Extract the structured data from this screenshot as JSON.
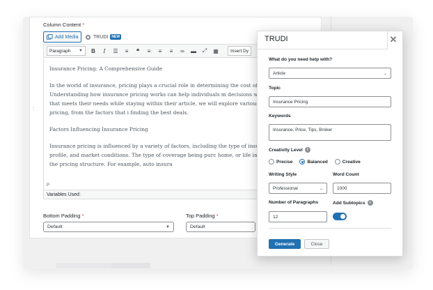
{
  "editor": {
    "column_label": "Column Content",
    "required_mark": "*",
    "add_media_label": "Add Media",
    "trudi_tab_label": "TRUDI",
    "new_badge": "NEW",
    "format_select": "Paragraph",
    "insert_label": "Insert Dy",
    "paragraphs": [
      "Insurance Pricing: A Comprehensive Guide",
      "In the world of insurance, pricing plays a crucial role in determining the cost of co policyholders. Understanding how insurance pricing works can help individuals m decisions when selecting a policy that meets their needs while staying within their article, we will explore various aspects of insurance pricing, from the factors that i finding the best deals.",
      "Factors Influencing Insurance Pricing",
      "Insurance pricing is influenced by a variety of factors, including the type of insura policyholder's risk profile, and market conditions. The type of coverage being purc home, or life insurance, will impact the pricing structure. For example, auto insura"
    ],
    "path_marker": "P",
    "variables_used": "Variables Used:"
  },
  "padding": {
    "bottom_label": "Bottom Padding",
    "bottom_value": "Default",
    "top_label": "Top Padding",
    "top_value": "Default"
  },
  "dialog": {
    "title": "TRUDI",
    "close_glyph": "✕",
    "help_label": "What do you need help with?",
    "help_value": "Article",
    "topic_label": "Topic",
    "topic_value": "Insurance Pricing",
    "keywords_label": "Keywords",
    "keywords_value": "Insurance, Price, Tips, Broker",
    "creativity_label": "Creativity Level",
    "creativity_options": [
      "Precise",
      "Balanced",
      "Creative"
    ],
    "creativity_selected": "Balanced",
    "style_label": "Writing Style",
    "style_value": "Professional",
    "wordcount_label": "Word Count",
    "wordcount_value": "1000",
    "paragraphs_label": "Number of Paragraphs",
    "paragraphs_value": "12",
    "subtopics_label": "Add Subtopics",
    "subtopics_on": true,
    "generate_label": "Generate",
    "close_label": "Close"
  },
  "icons": {
    "media": "media-icon",
    "trudi": "trudi-icon",
    "info": "info-icon",
    "chevron": "chevron-down-icon"
  },
  "colors": {
    "accent": "#2271b1",
    "required": "#d63638"
  }
}
